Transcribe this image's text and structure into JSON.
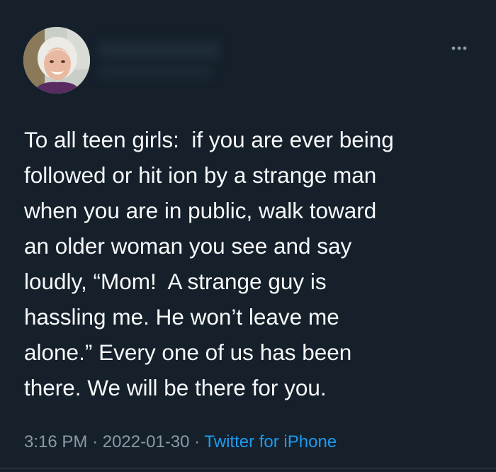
{
  "tweet": {
    "text_lines": [
      "To all teen girls:  if you are ever being",
      "followed or hit ion by a strange man",
      "when you are in public, walk toward",
      "an older woman you see and say",
      "loudly, “Mom!  A strange guy is",
      "hassling me. He won’t leave me",
      "alone.” Every one of us has been",
      "there. We will be there for you."
    ],
    "time": "3:16 PM",
    "separator": "·",
    "date": "2022-01-30",
    "source": "Twitter for iPhone"
  },
  "icons": {
    "more": "more-horizontal-icon"
  },
  "colors": {
    "background": "#15202b",
    "text": "#f7f9f9",
    "secondary_text": "#8b98a5",
    "link": "#1d9bf0"
  }
}
